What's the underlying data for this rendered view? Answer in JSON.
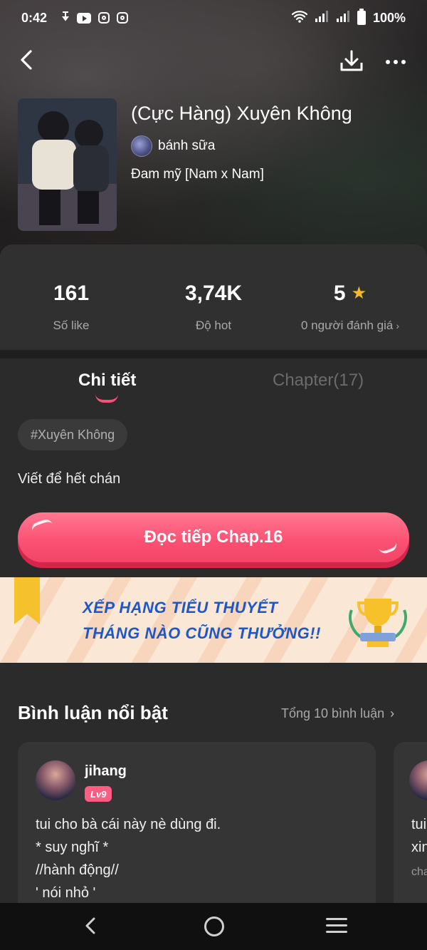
{
  "status_bar": {
    "time": "0:42",
    "battery": "100%",
    "icons": [
      "notification-icon",
      "youtube-icon",
      "instagram-icon",
      "instagram-icon",
      "wifi-icon",
      "signal-icon",
      "signal-icon",
      "battery-icon"
    ]
  },
  "header": {
    "icons": [
      "back-arrow-icon",
      "download-icon",
      "more-icon"
    ]
  },
  "story": {
    "title": "(Cực Hàng) Xuyên Không",
    "author": "bánh sữa",
    "genre": "Đam mỹ [Nam x Nam]"
  },
  "stats": [
    {
      "value": "161",
      "label": "Số like"
    },
    {
      "value": "3,74K",
      "label": "Độ hot"
    },
    {
      "value": "5",
      "label": "0 người đánh giá"
    }
  ],
  "tabs": [
    {
      "label": "Chi tiết",
      "active": true
    },
    {
      "label": "Chapter(17)",
      "active": false
    }
  ],
  "tag": "#Xuyên Không",
  "description": "Viết để hết chán",
  "read_button": "Đọc tiếp Chap.16",
  "banner": {
    "line1": "XẾP HẠNG TIỂU THUYẾT",
    "line2": "THÁNG NÀO CŨNG THƯỞNG!!"
  },
  "comments": {
    "title": "Bình luận nổi bật",
    "total": "Tổng 10 bình luận",
    "items": [
      {
        "user": "jihang",
        "level": "Lv9",
        "lines": [
          "tui cho bà cái này nè dùng đi.",
          "* suy nghĩ *",
          "//hành động//",
          "' nói nhỏ '"
        ]
      },
      {
        "lines": [
          "tui",
          "xin"
        ],
        "sub": "cha"
      }
    ]
  },
  "colors": {
    "accent": "#fb5072",
    "star": "#f7b928",
    "panel": "#2b2b2b",
    "banner_text": "#1d57c8"
  }
}
